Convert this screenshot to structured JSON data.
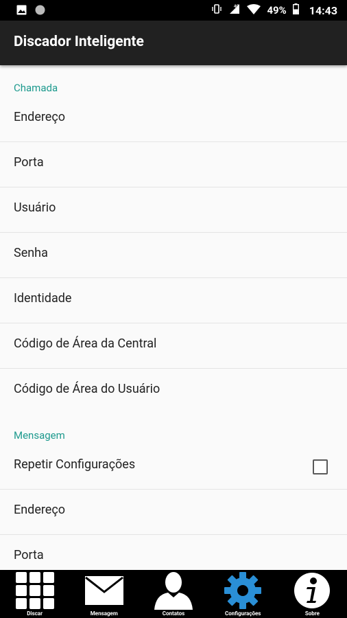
{
  "status_bar": {
    "battery_percent": "49%",
    "time": "14:43",
    "network": "4G"
  },
  "app_bar": {
    "title": "Discador Inteligente"
  },
  "settings": {
    "cat_chamada": "Chamada",
    "chamada_items": [
      "Endereço",
      "Porta",
      "Usuário",
      "Senha",
      "Identidade",
      "Código de Área da Central",
      "Código de Área do Usuário"
    ],
    "cat_mensagem": "Mensagem",
    "repeat_label": "Repetir Configurações",
    "repeat_checked": false,
    "mensagem_items": [
      "Endereço",
      "Porta"
    ]
  },
  "bottom_nav": [
    {
      "label": "Discar",
      "icon": "dialpad-icon"
    },
    {
      "label": "Mensagem",
      "icon": "envelope-icon"
    },
    {
      "label": "Contatos",
      "icon": "person-icon"
    },
    {
      "label": "Configurações",
      "icon": "gear-icon",
      "active": true
    },
    {
      "label": "Sobre",
      "icon": "info-icon"
    }
  ],
  "colors": {
    "accent": "#1e9a8e",
    "appbar": "#212121",
    "active_nav": "#2a8fd6"
  }
}
